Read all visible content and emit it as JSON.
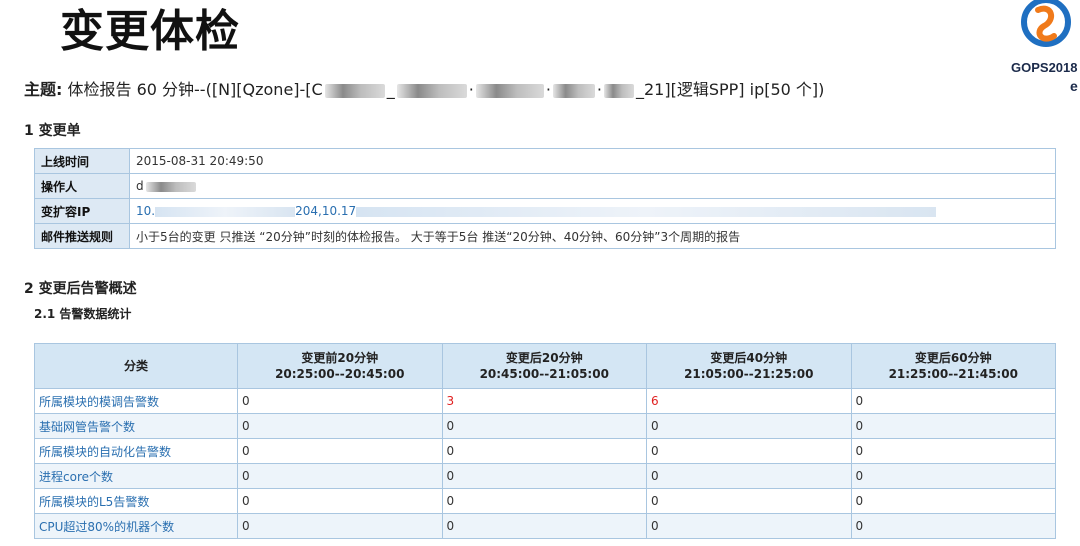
{
  "title": "变更体检",
  "logo": {
    "text": "GOPS2018",
    "sub": "e"
  },
  "subject": {
    "label": "主题:",
    "prefix": "体检报告 60 分钟--([N][Qzone]-[C",
    "suffix": "21][逻辑SPP] ip[50 个])"
  },
  "section1": {
    "heading": "1 变更单"
  },
  "change_order": {
    "rows": [
      {
        "key": "上线时间",
        "value": "2015-08-31 20:49:50"
      },
      {
        "key": "操作人",
        "value": "d"
      },
      {
        "key": "变扩容IP",
        "value_a": "10.",
        "value_b": "204,10.17"
      },
      {
        "key": "邮件推送规则",
        "value": "小于5台的变更 只推送 “20分钟”时刻的体检报告。 大于等于5台 推送“20分钟、40分钟、60分钟”3个周期的报告"
      }
    ]
  },
  "section2": {
    "heading": "2 变更后告警概述",
    "sub": "2.1 告警数据统计"
  },
  "stats_table": {
    "headers": [
      {
        "line1": "分类",
        "line2": ""
      },
      {
        "line1": "变更前20分钟",
        "line2": "20:25:00--20:45:00"
      },
      {
        "line1": "变更后20分钟",
        "line2": "20:45:00--21:05:00"
      },
      {
        "line1": "变更后40分钟",
        "line2": "21:05:00--21:25:00"
      },
      {
        "line1": "变更后60分钟",
        "line2": "21:25:00--21:45:00"
      }
    ],
    "rows": [
      {
        "cat": "所属模块的模调告警数",
        "v": [
          "0",
          "3",
          "6",
          "0"
        ]
      },
      {
        "cat": "基础网管告警个数",
        "v": [
          "0",
          "0",
          "0",
          "0"
        ]
      },
      {
        "cat": "所属模块的自动化告警数",
        "v": [
          "0",
          "0",
          "0",
          "0"
        ]
      },
      {
        "cat": "进程core个数",
        "v": [
          "0",
          "0",
          "0",
          "0"
        ]
      },
      {
        "cat": "所属模块的L5告警数",
        "v": [
          "0",
          "0",
          "0",
          "0"
        ]
      },
      {
        "cat": "CPU超过80%的机器个数",
        "v": [
          "0",
          "0",
          "0",
          "0"
        ]
      }
    ],
    "highlight_color": "#e02020"
  }
}
